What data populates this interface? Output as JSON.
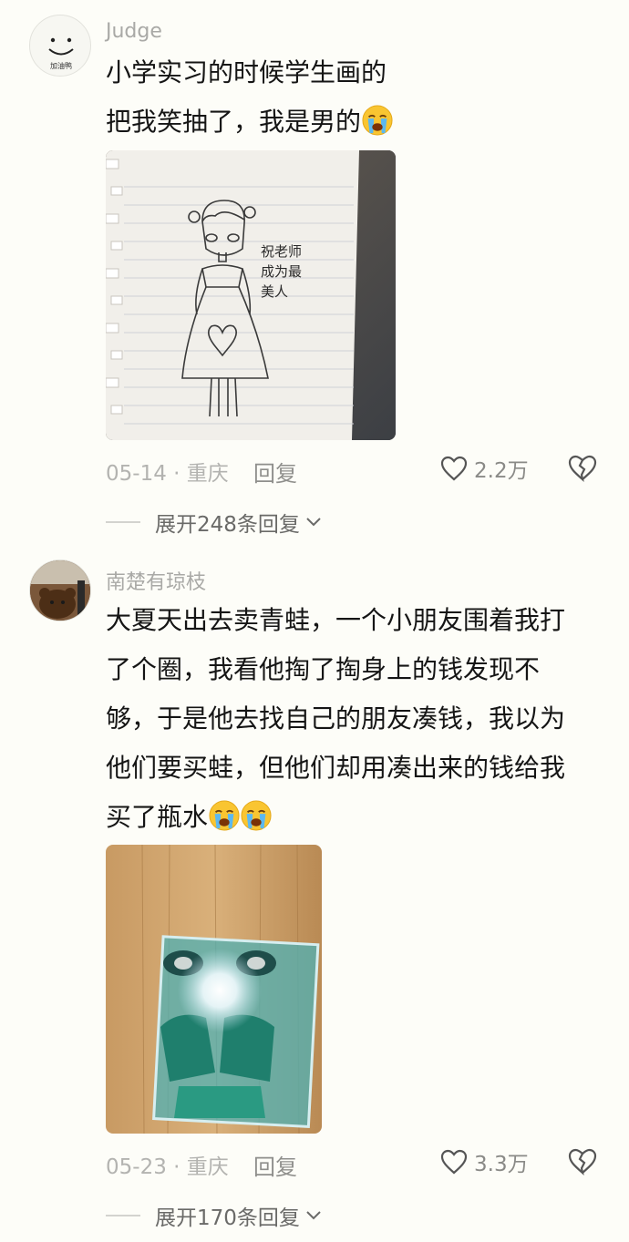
{
  "comments": [
    {
      "username": "Judge",
      "avatar_caption": "加油鸭",
      "text_lines": [
        "小学实习的时候学生画的",
        "把我笑抽了，我是男的"
      ],
      "emoji": "loudly-crying-face",
      "photo_handwriting": "祝老师成为最美人",
      "date": "05-14",
      "location": "重庆",
      "reply_label": "回复",
      "likes": "2.2万",
      "expand_label": "展开248条回复"
    },
    {
      "username": "南楚有琼枝",
      "text_lines": [
        "大夏天出去卖青蛙，一个小朋友围着我打",
        "了个圈，我看他掏了掏身上的钱发现不",
        "够，于是他去找自己的朋友凑钱，我以为",
        "他们要买蛙，但他们却用凑出来的钱给我",
        "买了瓶水"
      ],
      "emoji": "loudly-crying-face",
      "date": "05-23",
      "location": "重庆",
      "reply_label": "回复",
      "likes": "3.3万",
      "expand_label": "展开170条回复"
    }
  ],
  "colors": {
    "background": "#fdfdf8",
    "username": "#a9a9a6",
    "meta": "#b3b3b0",
    "text": "#151515"
  },
  "icons": [
    "heart-outline-icon",
    "broken-heart-icon",
    "chevron-down-icon",
    "loudly-crying-face-emoji"
  ]
}
